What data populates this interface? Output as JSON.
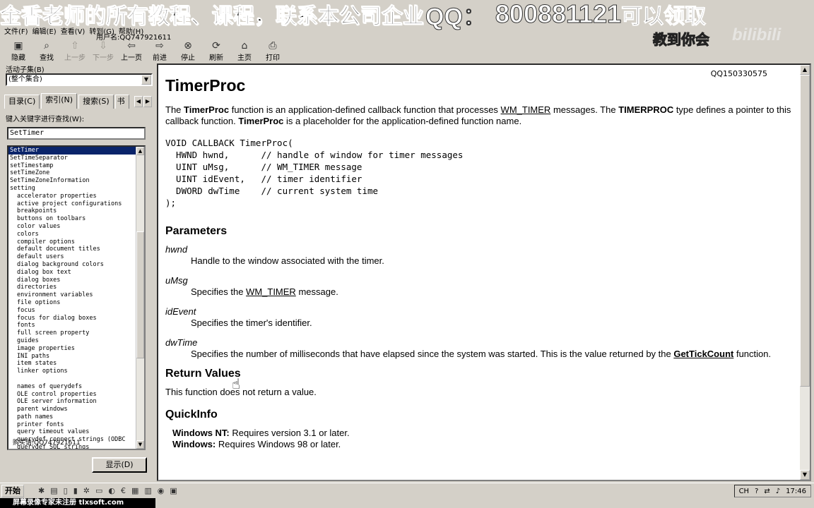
{
  "overlay": {
    "banner_cn": "金香老师的所有教程、课程，联系本公司企业",
    "banner_qq": "QQ：",
    "banner_number": "800881121",
    "banner_tail": "可以领取",
    "sub_banner": "教到你会",
    "bili_logo": "bilibili",
    "username": "用户名:QQ747921611"
  },
  "menubar": {
    "items": [
      "文件(F)",
      "编辑(E)",
      "查看(V)",
      "转到(G)",
      "帮助(H)"
    ]
  },
  "toolbar": {
    "buttons": [
      {
        "label": "隐藏",
        "icon": "▣"
      },
      {
        "label": "查找",
        "icon": "⌕"
      },
      {
        "label": "上一步",
        "icon": "⇧"
      },
      {
        "label": "下一步",
        "icon": "⇩"
      },
      {
        "label": "上一页",
        "icon": "⇦"
      },
      {
        "label": "前进",
        "icon": "⇨"
      },
      {
        "label": "停止",
        "icon": "⊗"
      },
      {
        "label": "刷新",
        "icon": "⟳"
      },
      {
        "label": "主页",
        "icon": "⌂"
      },
      {
        "label": "打印",
        "icon": "⎙"
      }
    ]
  },
  "nav": {
    "subset_label": "活动子集(B)",
    "subset_value": "(整个集合)",
    "tabs": [
      "目录(C)",
      "索引(N)",
      "搜索(S)",
      "书(O)"
    ],
    "keyword_label": "键入关键字进行查找(W):",
    "keyword_value": "SetTimer",
    "list_overlay_text": "购买请:QQ747921611",
    "display_button": "显示(D)",
    "items": [
      {
        "t": "SetTimer",
        "lvl": 1,
        "sel": true
      },
      {
        "t": "SetTimeSeparator",
        "lvl": 1
      },
      {
        "t": "setTimestamp",
        "lvl": 1
      },
      {
        "t": "setTimeZone",
        "lvl": 1
      },
      {
        "t": "SetTimeZoneInformation",
        "lvl": 1
      },
      {
        "t": "setting",
        "lvl": 1
      },
      {
        "t": "accelerator properties",
        "lvl": 2
      },
      {
        "t": "active project configurations",
        "lvl": 2
      },
      {
        "t": "breakpoints",
        "lvl": 2
      },
      {
        "t": "buttons on toolbars",
        "lvl": 2
      },
      {
        "t": "color values",
        "lvl": 2
      },
      {
        "t": "colors",
        "lvl": 2
      },
      {
        "t": "compiler options",
        "lvl": 2
      },
      {
        "t": "default document titles",
        "lvl": 2
      },
      {
        "t": "default users",
        "lvl": 2
      },
      {
        "t": "dialog background colors",
        "lvl": 2
      },
      {
        "t": "dialog box text",
        "lvl": 2
      },
      {
        "t": "dialog boxes",
        "lvl": 2
      },
      {
        "t": "directories",
        "lvl": 2
      },
      {
        "t": "environment variables",
        "lvl": 2
      },
      {
        "t": "file options",
        "lvl": 2
      },
      {
        "t": "focus",
        "lvl": 2
      },
      {
        "t": "focus for dialog boxes",
        "lvl": 2
      },
      {
        "t": "fonts",
        "lvl": 2
      },
      {
        "t": "full screen property",
        "lvl": 2
      },
      {
        "t": "guides",
        "lvl": 2
      },
      {
        "t": "image properties",
        "lvl": 2
      },
      {
        "t": "INI paths",
        "lvl": 2
      },
      {
        "t": "item states",
        "lvl": 2
      },
      {
        "t": "linker options",
        "lvl": 2
      },
      {
        "t": "",
        "lvl": 2
      },
      {
        "t": "names of querydefs",
        "lvl": 2
      },
      {
        "t": "OLE control properties",
        "lvl": 2
      },
      {
        "t": "OLE server information",
        "lvl": 2
      },
      {
        "t": "parent windows",
        "lvl": 2
      },
      {
        "t": "path names",
        "lvl": 2
      },
      {
        "t": "printer fonts",
        "lvl": 2
      },
      {
        "t": "query timeout values",
        "lvl": 2
      },
      {
        "t": "querydef connect strings (ODBC",
        "lvl": 2
      },
      {
        "t": "querydef SQL strings",
        "lvl": 2
      }
    ]
  },
  "doc": {
    "qq_tag": "QQ150330575",
    "title": "TimerProc",
    "intro_parts": {
      "p1": "The ",
      "b1": "TimerProc",
      "p2": " function is an application-defined callback function that processes ",
      "link1": "WM_TIMER",
      "p3": " messages. The ",
      "b2": "TIMERPROC",
      "p4": " type defines a pointer to this callback function. ",
      "b3": "TimerProc",
      "p5": " is a placeholder for the application-defined function name."
    },
    "code": "VOID CALLBACK TimerProc(\n  HWND hwnd,      // handle of window for timer messages\n  UINT uMsg,      // WM_TIMER message\n  UINT idEvent,   // timer identifier\n  DWORD dwTime    // current system time\n);",
    "parameters_heading": "Parameters",
    "params": [
      {
        "name": "hwnd",
        "desc_a": "Handle to the window associated with the timer.",
        "link": "",
        "desc_b": ""
      },
      {
        "name": "uMsg",
        "desc_a": "Specifies the ",
        "link": "WM_TIMER",
        "desc_b": " message."
      },
      {
        "name": "idEvent",
        "desc_a": "Specifies the timer's identifier.",
        "link": "",
        "desc_b": ""
      },
      {
        "name": "dwTime",
        "desc_a": "Specifies the number of milliseconds that have elapsed since the system was started. This is the value returned by the ",
        "link": "GetTickCount",
        "desc_b": " function."
      }
    ],
    "return_heading": "Return Values",
    "return_text": "This function does not return a value.",
    "quickinfo_heading": "QuickInfo",
    "quickinfo": [
      {
        "label": "Windows NT:",
        "text": " Requires version 3.1 or later."
      },
      {
        "label": "Windows:",
        "text": " Requires Windows 98 or later."
      }
    ]
  },
  "taskbar": {
    "start_label": "开始",
    "tray_ime": "CH",
    "clock": "17:46"
  },
  "watermark": "屏幕录像专家未注册 tlxsoft.com"
}
